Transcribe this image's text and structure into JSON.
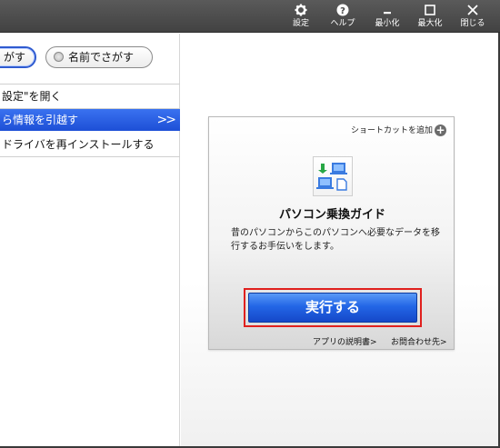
{
  "titlebar": {
    "buttons": [
      {
        "name": "settings",
        "label": "設定"
      },
      {
        "name": "help",
        "label": "ヘルプ"
      },
      {
        "name": "minimize",
        "label": "最小化"
      },
      {
        "name": "maximize",
        "label": "最大化"
      },
      {
        "name": "close",
        "label": "閉じる"
      }
    ]
  },
  "search": {
    "by_purpose_label": "がす",
    "by_name_label": "名前でさがす"
  },
  "list": {
    "items": [
      {
        "label": "設定\"を開く"
      },
      {
        "label": "ら情報を引越す",
        "chevron": ">>"
      },
      {
        "label": "ドライバを再インストールする"
      }
    ]
  },
  "card": {
    "shortcut_label": "ショートカットを追加",
    "title": "パソコン乗換ガイド",
    "description": "昔のパソコンからこのパソコンへ必要なデータを移行するお手伝いをします。",
    "execute_label": "実行する",
    "manual_link": "アプリの説明書>",
    "contact_link": "お問合わせ先>"
  },
  "colors": {
    "titlebar": "#4a4a4a",
    "selected": "#2f62e0",
    "execute": "#2366e6",
    "highlight": "#e0201e"
  }
}
